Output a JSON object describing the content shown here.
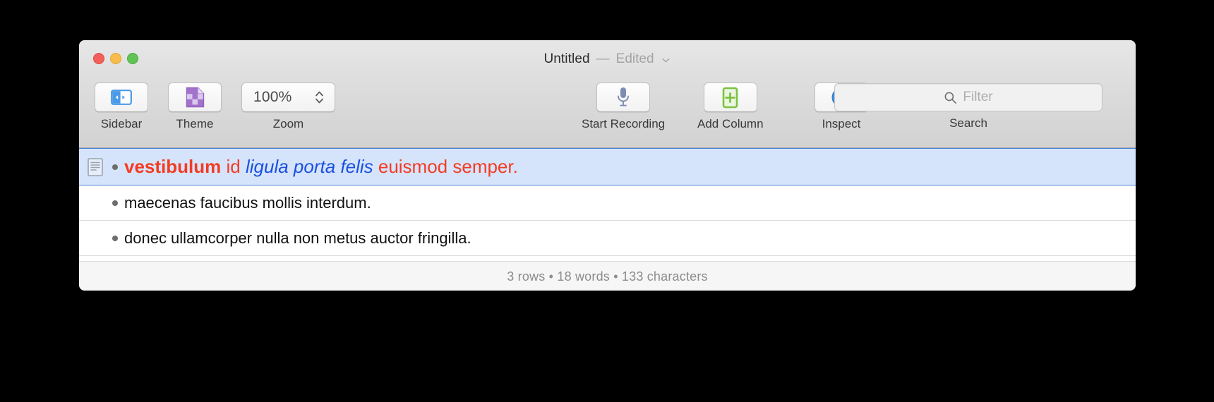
{
  "window": {
    "title": "Untitled",
    "separator": "—",
    "edited_label": "Edited",
    "title_menu_icon": "chevron-down-icon",
    "traffic_lights": {
      "close": "close-window-button",
      "minimize": "minimize-window-button",
      "zoom": "zoom-window-button"
    }
  },
  "toolbar": {
    "sidebar": {
      "label": "Sidebar",
      "icon": "sidebar-toggle-icon"
    },
    "theme": {
      "label": "Theme",
      "icon": "theme-document-icon"
    },
    "zoom": {
      "label": "Zoom",
      "value": "100%",
      "stepper_icon": "stepper-up-down-icon"
    },
    "record": {
      "label": "Start Recording",
      "icon": "microphone-icon"
    },
    "add_column": {
      "label": "Add Column",
      "icon": "add-column-plus-icon"
    },
    "inspect": {
      "label": "Inspect",
      "icon": "info-circle-icon"
    },
    "search": {
      "label": "Search",
      "placeholder": "Filter",
      "icon": "search-icon"
    }
  },
  "colors": {
    "accent_red": "#f43b22",
    "accent_blue": "#1a4fe0",
    "selection_blue": "#d5e4fb",
    "selection_border": "#4a85d6",
    "icon_blue": "#4a9ae8",
    "icon_green": "#7dc242",
    "icon_purple": "#a273cc",
    "icon_mic": "#7e8cb4"
  },
  "rows": [
    {
      "selected": true,
      "has_doc_icon": true,
      "bullet": "•",
      "segments": [
        {
          "text": "vestibulum",
          "style": "bold-red"
        },
        {
          "text": " ",
          "style": "plain"
        },
        {
          "text": "id",
          "style": "red"
        },
        {
          "text": " ",
          "style": "plain"
        },
        {
          "text": "ligula porta felis",
          "style": "blue-italic"
        },
        {
          "text": " ",
          "style": "plain"
        },
        {
          "text": "euismod semper.",
          "style": "red"
        }
      ],
      "plain_text": "vestibulum id ligula porta felis euismod semper."
    },
    {
      "selected": false,
      "has_doc_icon": false,
      "bullet": "•",
      "segments": [
        {
          "text": "maecenas faucibus mollis interdum.",
          "style": "plain"
        }
      ],
      "plain_text": "maecenas faucibus mollis interdum."
    },
    {
      "selected": false,
      "has_doc_icon": false,
      "bullet": "•",
      "segments": [
        {
          "text": "donec ullamcorper nulla non metus auctor fringilla.",
          "style": "plain"
        }
      ],
      "plain_text": "donec ullamcorper nulla non metus auctor fringilla."
    }
  ],
  "statusbar": {
    "rows": "3 rows",
    "sep1": "•",
    "words": "18 words",
    "sep2": "•",
    "characters": "133 characters",
    "full": "3 rows • 18 words • 133 characters"
  }
}
